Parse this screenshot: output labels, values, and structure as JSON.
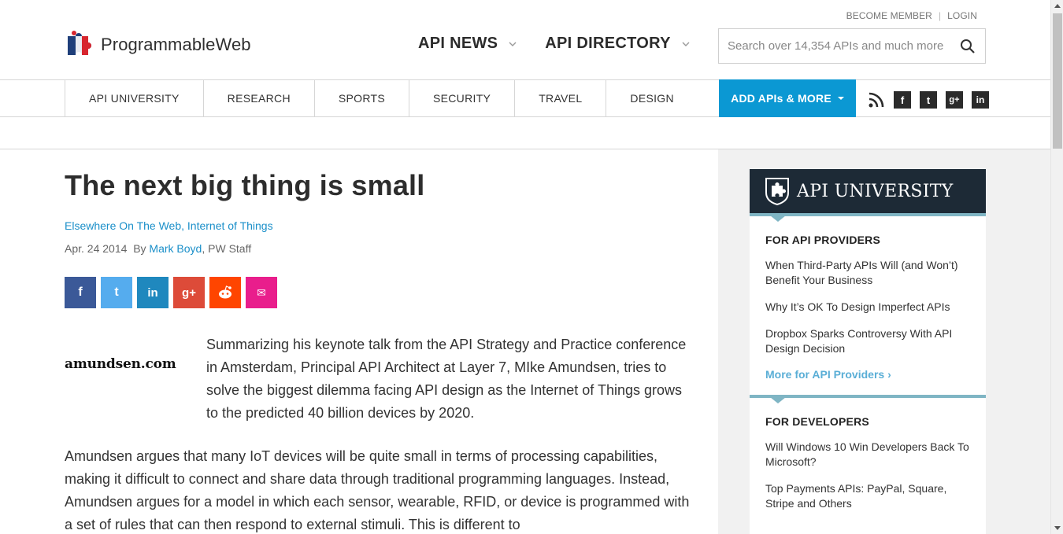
{
  "header": {
    "become_member": "BECOME MEMBER",
    "login": "LOGIN",
    "logo_text": "ProgrammableWeb",
    "nav": [
      {
        "label": "API NEWS"
      },
      {
        "label": "API DIRECTORY"
      }
    ],
    "search_placeholder": "Search over 14,354 APIs and much more"
  },
  "subnav": {
    "items": [
      {
        "label": "API UNIVERSITY"
      },
      {
        "label": "RESEARCH"
      },
      {
        "label": "SPORTS"
      },
      {
        "label": "SECURITY"
      },
      {
        "label": "TRAVEL"
      },
      {
        "label": "DESIGN"
      }
    ],
    "add_button": "ADD APIs & MORE",
    "social": [
      {
        "icon": "rss-icon",
        "glyph": ""
      },
      {
        "icon": "facebook-icon",
        "glyph": "f"
      },
      {
        "icon": "twitter-icon",
        "glyph": "t"
      },
      {
        "icon": "google-plus-icon",
        "glyph": "g+"
      },
      {
        "icon": "linkedin-icon",
        "glyph": "in"
      }
    ]
  },
  "article": {
    "title": "The next big thing is small",
    "categories": "Elsewhere On The Web, Internet of Things",
    "date": "Apr. 24 2014",
    "by": "By",
    "author": "Mark Boyd",
    "author_suffix": ", PW Staff",
    "share_buttons": [
      {
        "icon": "facebook-share-icon",
        "glyph": "f",
        "color": "#3b5998"
      },
      {
        "icon": "twitter-share-icon",
        "glyph": "t",
        "color": "#55acee"
      },
      {
        "icon": "linkedin-share-icon",
        "glyph": "in",
        "color": "#1f88be"
      },
      {
        "icon": "google-plus-share-icon",
        "glyph": "g+",
        "color": "#dd4b39"
      },
      {
        "icon": "reddit-share-icon",
        "glyph": "r",
        "color": "#ff4500"
      },
      {
        "icon": "email-share-icon",
        "glyph": "✉",
        "color": "#e91e8c"
      }
    ],
    "thumb_text": "amundsen.com",
    "intro": "Summarizing his keynote talk from the API Strategy and Practice conference in Amsterdam, Principal API Architect at Layer 7, MIke Amundsen, tries to solve the biggest dilemma facing API design as the Internet of Things grows to the predicted 40 billion devices by 2020.",
    "body": "Amundsen argues that many IoT devices will be quite small in terms of processing capabilities, making it difficult to connect and share data through traditional programming languages. Instead, Amundsen argues for a model in which each sensor, wearable, RFID, or device is programmed with a set of rules that can then respond to external stimuli. This is different to"
  },
  "sidebar": {
    "title": "API UNIVERSITY",
    "sections": [
      {
        "heading": "FOR API PROVIDERS",
        "links": [
          "When Third-Party APIs Will (and Won’t) Benefit Your Business",
          "Why It’s OK To Design Imperfect APIs",
          "Dropbox Sparks Controversy With API Design Decision"
        ],
        "more": "More for API Providers  ›"
      },
      {
        "heading": "FOR DEVELOPERS",
        "links": [
          "Will Windows 10 Win Developers Back To Microsoft?",
          "Top Payments APIs: PayPal, Square, Stripe and Others"
        ]
      }
    ]
  },
  "colors": {
    "accent": "#0b98d3",
    "link": "#1a8fc9",
    "sidebar_header": "#1d2a36",
    "sidebar_rule": "#7fb5c4"
  }
}
